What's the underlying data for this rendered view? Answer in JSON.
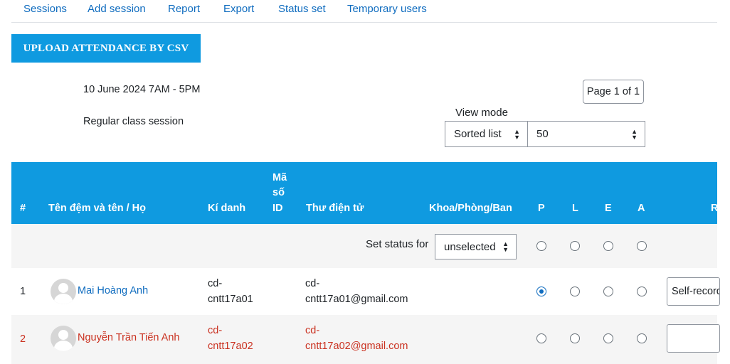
{
  "nav": {
    "items": [
      "Sessions",
      "Add session",
      "Report",
      "Export",
      "Status set",
      "Temporary users"
    ]
  },
  "upload_button": "Upload attendance by CSV",
  "session": {
    "date": "10 June 2024 7AM - 5PM",
    "description": "Regular class session"
  },
  "pager": "Page 1 of 1",
  "view_mode": {
    "label": "View mode",
    "sort_value": "Sorted list",
    "perpage_value": "50"
  },
  "table": {
    "headers": {
      "num": "#",
      "name": "Tên đệm và tên / Họ",
      "username": "Kí danh",
      "id_line1": "Mã",
      "id_line2": "số",
      "id_line3": "ID",
      "email": "Thư điện tử",
      "department": "Khoa/Phòng/Ban",
      "p": "P",
      "l": "L",
      "e": "E",
      "a": "A",
      "remarks": "R"
    },
    "set_status": {
      "label": "Set status for",
      "value": "unselected"
    },
    "rows": [
      {
        "num": "1",
        "name": "Mai Hoàng Anh",
        "username_line1": "cd-",
        "username_line2": "cntt17a01",
        "email_line1": "cd-",
        "email_line2": "cntt17a01@gmail.com",
        "selected": "P",
        "remark": "Self-recorded"
      },
      {
        "num": "2",
        "name": "Nguyễn Trần Tiến Anh",
        "username_line1": "cd-",
        "username_line2": "cntt17a02",
        "email_line1": "cd-",
        "email_line2": "cntt17a02@gmail.com",
        "selected": "",
        "remark": ""
      }
    ]
  },
  "colors": {
    "accent": "#0f9ae0",
    "link": "#0f6cbf",
    "warning_text": "#ca3120",
    "row_alt": "#f5f5f5"
  }
}
